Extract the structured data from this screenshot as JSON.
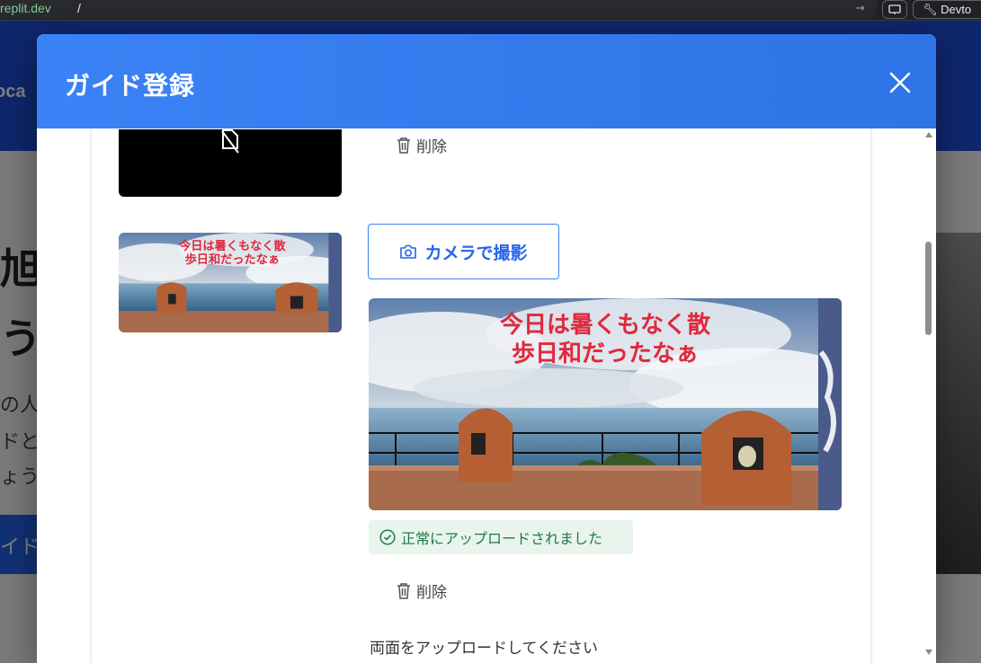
{
  "browser": {
    "host_prefix": "",
    "host": "replit.dev",
    "path": "/",
    "devtools_label": "Devto"
  },
  "background": {
    "logo": "oca",
    "hero_line1": "旭均",
    "hero_line2": "う、",
    "para_line1": "の人",
    "para_line2": "ドと",
    "para_line3": "ょう",
    "cta": "イド"
  },
  "modal": {
    "title": "ガイド登録",
    "close_icon": "close-icon"
  },
  "upload_item_1": {
    "delete_label": "削除"
  },
  "upload_item_2": {
    "camera_label": "カメラで撮影",
    "photo_caption_line1": "今日は暑くもなく散",
    "photo_caption_line2": "歩日和だったなぁ",
    "success_message": "正常にアップロードされました",
    "delete_label": "削除"
  },
  "hint": "両面をアップロードしてください",
  "colors": {
    "header_blue": "#3b82f6",
    "accent": "#2563eb",
    "success_bg": "#e8f4ec",
    "success_text": "#1f7a45",
    "caption_red": "#e0283c"
  }
}
